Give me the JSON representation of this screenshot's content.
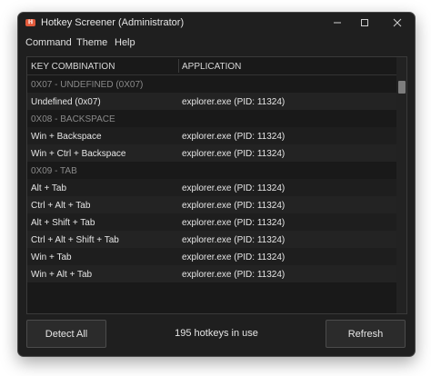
{
  "window": {
    "title": "Hotkey Screener (Administrator)",
    "icon": "app-icon",
    "icon_text": "ℍ"
  },
  "menu": [
    "Command",
    "Theme",
    "Help"
  ],
  "columns": [
    "KEY COMBINATION",
    "APPLICATION"
  ],
  "rows": [
    {
      "type": "group",
      "key": "0X07 - UNDEFINED (0X07)"
    },
    {
      "type": "data",
      "key": "Undefined (0x07)",
      "app": "explorer.exe (PID: 11324)"
    },
    {
      "type": "group",
      "key": "0X08 - BACKSPACE"
    },
    {
      "type": "data",
      "key": "Win + Backspace",
      "app": "explorer.exe (PID: 11324)"
    },
    {
      "type": "data",
      "key": "Win + Ctrl + Backspace",
      "app": "explorer.exe (PID: 11324)"
    },
    {
      "type": "group",
      "key": "0X09 - TAB"
    },
    {
      "type": "data",
      "key": "Alt + Tab",
      "app": "explorer.exe (PID: 11324)"
    },
    {
      "type": "data",
      "key": "Ctrl + Alt + Tab",
      "app": "explorer.exe (PID: 11324)"
    },
    {
      "type": "data",
      "key": "Alt + Shift + Tab",
      "app": "explorer.exe (PID: 11324)"
    },
    {
      "type": "data",
      "key": "Ctrl + Alt + Shift + Tab",
      "app": "explorer.exe (PID: 11324)"
    },
    {
      "type": "data",
      "key": "Win + Tab",
      "app": "explorer.exe (PID: 11324)"
    },
    {
      "type": "data",
      "key": "Win + Alt + Tab",
      "app": "explorer.exe (PID: 11324)"
    }
  ],
  "footer": {
    "detect_label": "Detect All",
    "status": "195 hotkeys in use",
    "refresh_label": "Refresh"
  }
}
